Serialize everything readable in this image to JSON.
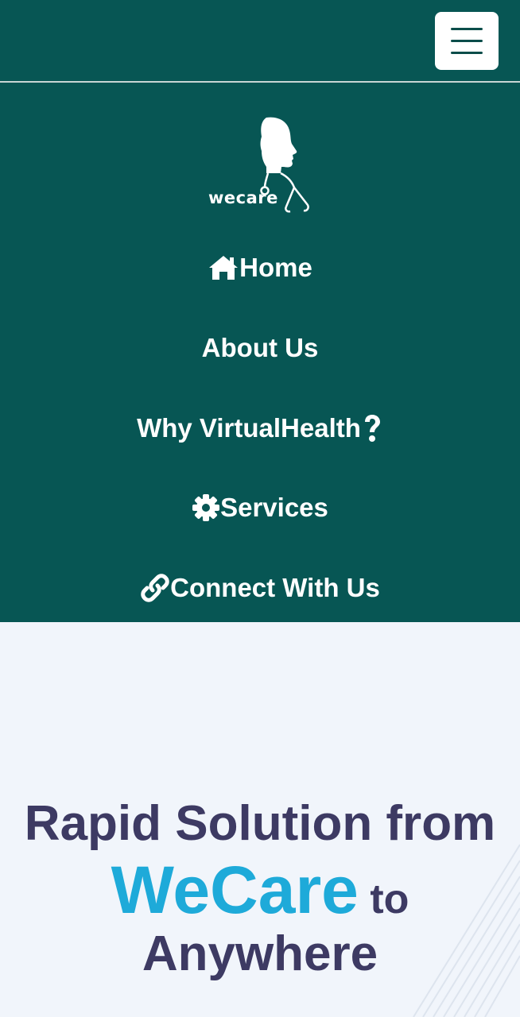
{
  "header": {
    "menu_toggle_icon": "hamburger-icon",
    "background_color": "#075654"
  },
  "menu": {
    "logo_text": "wecare",
    "items": [
      {
        "label": "Home",
        "icon": "home-icon"
      },
      {
        "label": "About Us",
        "icon": ""
      },
      {
        "label": "Why VirtualHealth",
        "icon": "question-icon"
      },
      {
        "label": "Services",
        "icon": "gear-icon"
      },
      {
        "label": "Connect With Us",
        "icon": "link-icon"
      }
    ]
  },
  "hero": {
    "line1": "Rapid Solution from",
    "brand": "WeCare",
    "line2_suffix": "to",
    "line3": "Anywhere",
    "text_color": "#3d3a63",
    "brand_color": "#1eaad9"
  }
}
